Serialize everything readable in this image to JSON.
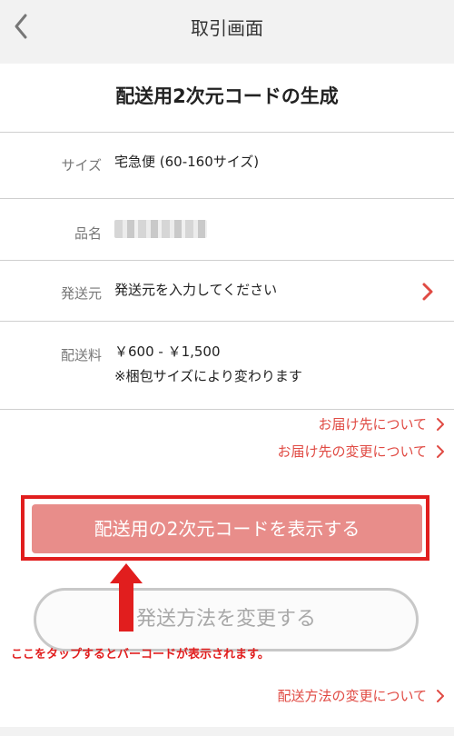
{
  "nav": {
    "title": "取引画面",
    "back_icon": "chevron-left-icon"
  },
  "heading": "配送用2次元コードの生成",
  "rows": [
    {
      "label": "サイズ",
      "value": "宅急便 (60-160サイズ)"
    },
    {
      "label": "品名",
      "value": ""
    },
    {
      "label": "発送元",
      "value": "発送元を入力してください"
    },
    {
      "label": "配送料",
      "value": "￥600 - ￥1,500",
      "note": "※梱包サイズにより変わります"
    }
  ],
  "links": {
    "delivery_about": "お届け先について",
    "delivery_change": "お届け先の変更について",
    "shipping_method_change": "配送方法の変更について"
  },
  "buttons": {
    "show_code": "配送用の2次元コードを表示する",
    "change_method": "発送方法を変更する"
  },
  "annotation": "ここをタップするとバーコードが表示されます。",
  "colors": {
    "accent": "#e04a43",
    "button": "#e88d8a",
    "annotation": "#e11e1e"
  }
}
